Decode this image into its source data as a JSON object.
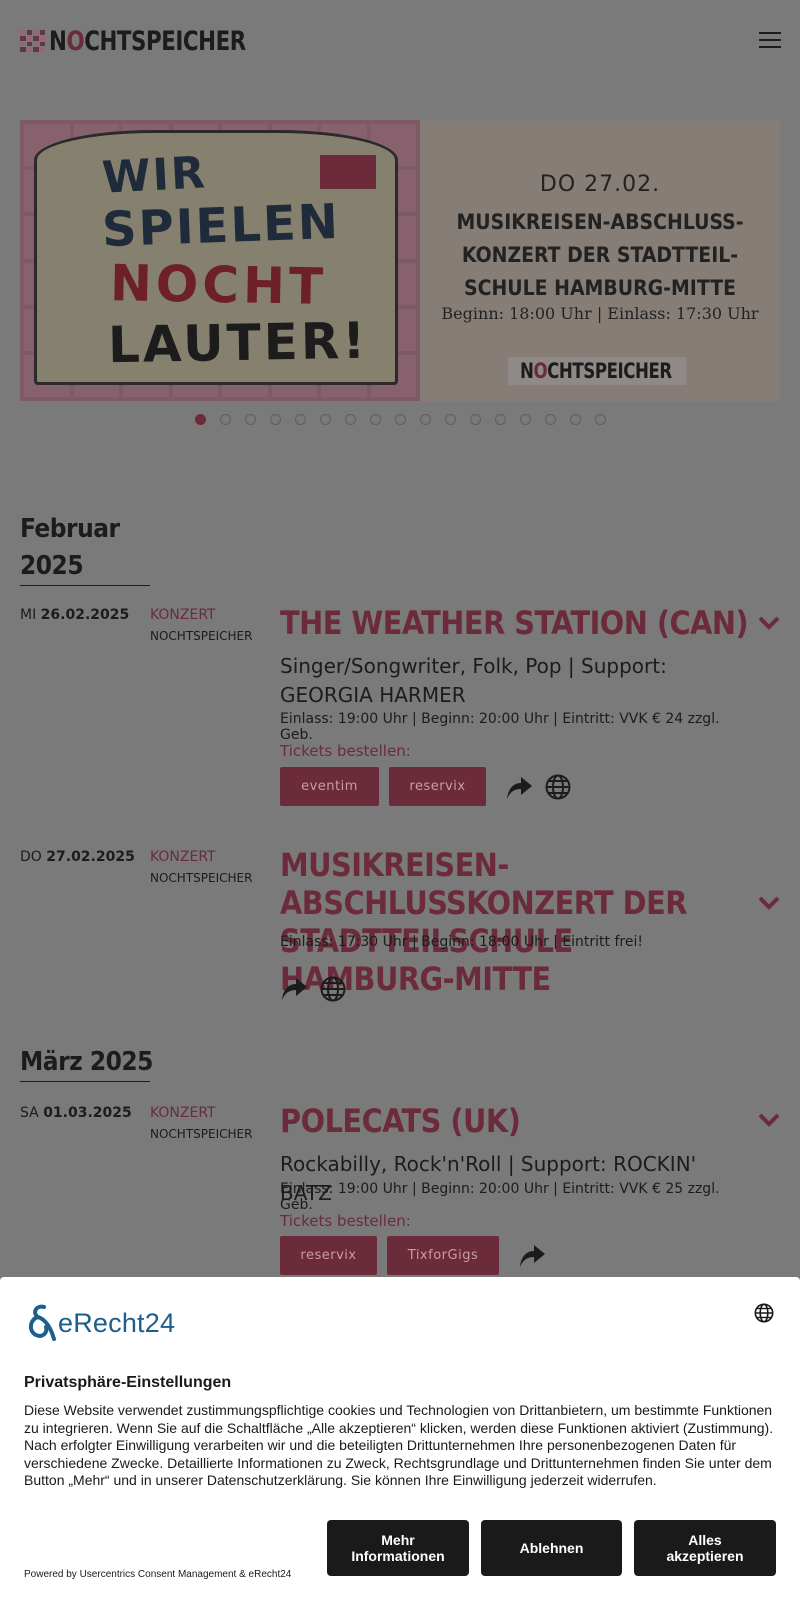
{
  "header": {
    "logo_text_pre": "N",
    "logo_text_o": "O",
    "logo_text_post": "CHTSPEICHER"
  },
  "slider": {
    "sign_lines": [
      "WIR",
      "SPIELEN",
      "NOCHT",
      "LAUTER!"
    ],
    "date": "DO 27.02.",
    "title": "MUSIKREISEN-ABSCHLUSS-KONZERT DER STADTTEIL-SCHULE HAMBURG-MITTE",
    "subtitle": "Beginn: 18:00 Uhr | Einlass: 17:30 Uhr",
    "logo_pre": "N",
    "logo_o": "O",
    "logo_post": "CHTSPEICHER",
    "dot_count": 17,
    "active_dot": 1
  },
  "months": {
    "feb": "Februar 2025",
    "mar": "März 2025"
  },
  "events": [
    {
      "weekday": "MI",
      "date": "26.02.2025",
      "category": "KONZERT",
      "venue": "NOCHTSPEICHER",
      "title": "THE WEATHER STATION (CAN)",
      "genre": "Singer/Songwriter, Folk, Pop | Support: GEORGIA HARMER",
      "info": "Einlass: 19:00 Uhr | Beginn: 20:00 Uhr | Eintritt: VVK € 24 zzgl. Geb.",
      "tickets_label": "Tickets bestellen:",
      "buttons": [
        "eventim",
        "reservix"
      ]
    },
    {
      "weekday": "DO",
      "date": "27.02.2025",
      "category": "KONZERT",
      "venue": "NOCHTSPEICHER",
      "title": "MUSIKREISEN-ABSCHLUSSKONZERT DER STADTTEILSCHULE HAMBURG-MITTE",
      "info": "Einlass: 17:30 Uhr | Beginn: 18:00 Uhr | Eintritt frei!"
    },
    {
      "weekday": "SA",
      "date": "01.03.2025",
      "category": "KONZERT",
      "venue": "NOCHTSPEICHER",
      "title": "POLECATS (UK)",
      "genre": "Rockabilly, Rock'n'Roll | Support: ROCKIN' BATZ",
      "info": "Einlass: 19:00 Uhr | Beginn: 20:00 Uhr | Eintritt: VVK € 25 zzgl. Geb.",
      "tickets_label": "Tickets bestellen:",
      "buttons": [
        "reservix",
        "TixforGigs"
      ]
    }
  ],
  "cookie": {
    "brand": "eRecht24",
    "title": "Privatsphäre-Einstellungen",
    "text": "Diese Website verwendet zustimmungspflichtige cookies und Technologien von Drittanbietern, um bestimmte Funktionen zu integrieren. Wenn Sie auf die Schaltfläche „Alle akzeptieren“ klicken, werden diese Funktionen aktiviert (Zustimmung). Nach erfolgter Einwilligung verarbeiten wir und die beteiligten Drittunternehmen Ihre personenbezogenen Daten für verschiedene Zwecke. Detaillierte Informationen zu Zweck, Rechtsgrundlage und Drittunternehmen finden Sie unter dem Button „Mehr“ und in unserer Datenschutzerklärung. Sie können Ihre Einwilligung jederzeit widerrufen.",
    "btn_more_line1": "Mehr",
    "btn_more_line2": "Informationen",
    "btn_decline": "Ablehnen",
    "btn_accept_line1": "Alles",
    "btn_accept_line2": "akzeptieren",
    "powered": "Powered by Usercentrics Consent Management & eRecht24"
  },
  "colors": {
    "accent": "#6b2b3a",
    "overlay_bg": "#7a7a7a",
    "banner_bg": "#ffffff",
    "button_dark": "#1a1a1a",
    "brand_blue": "#1c5f8a"
  },
  "icons": [
    "hamburger-menu-icon",
    "chevron-down-icon",
    "share-icon",
    "globe-icon",
    "language-icon"
  ]
}
